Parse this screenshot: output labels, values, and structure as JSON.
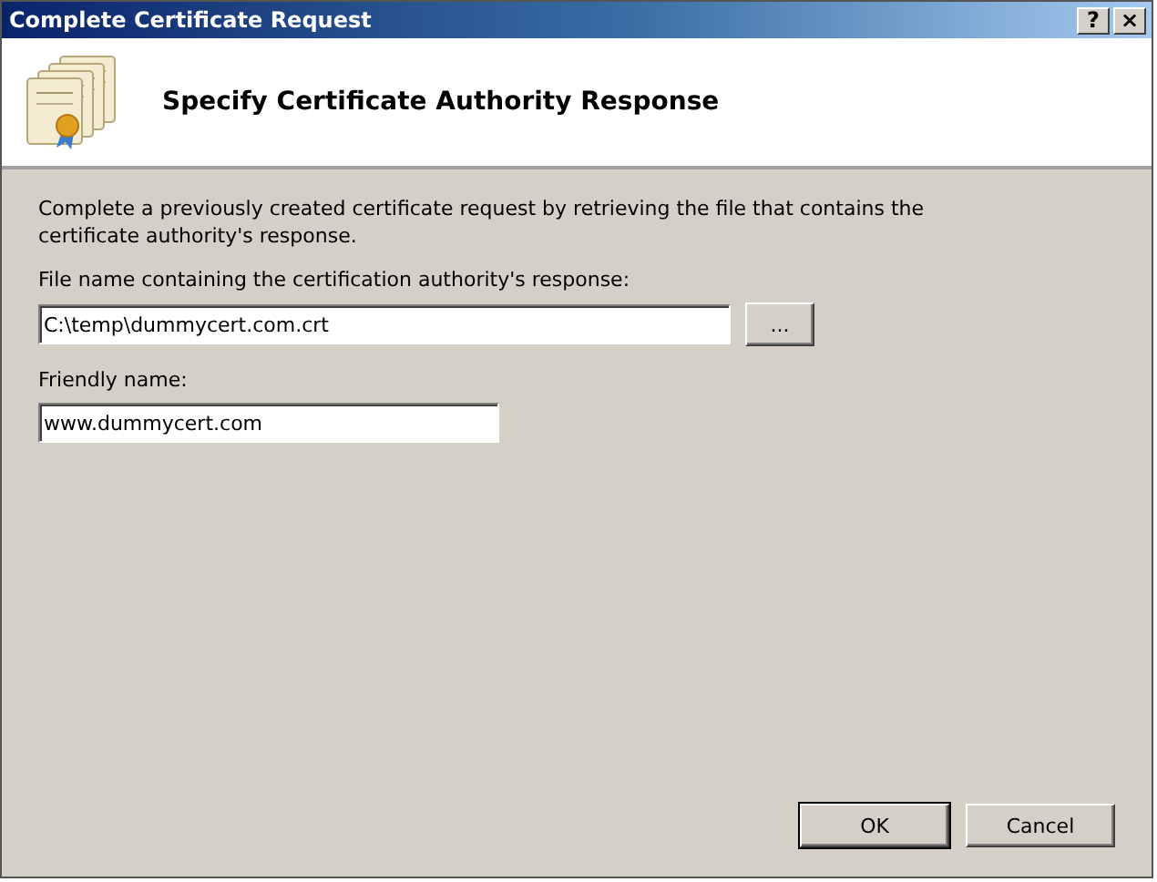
{
  "window": {
    "title": "Complete Certificate Request",
    "title_buttons": [
      "?",
      "×"
    ]
  },
  "header": {
    "title": "Specify Certificate Authority Response"
  },
  "description": "Complete a previously created certificate request by retrieving the file that contains the certificate authority's response.",
  "file_field": {
    "label": "File name containing the certification authority's response:",
    "value": "C:\\temp\\dummycert.com.crt",
    "browse_button": "..."
  },
  "friendly_field": {
    "label": "Friendly name:",
    "value": "www.dummycert.com"
  },
  "buttons": [
    {
      "label": "OK",
      "default": true
    },
    {
      "label": "Cancel",
      "default": false
    }
  ]
}
